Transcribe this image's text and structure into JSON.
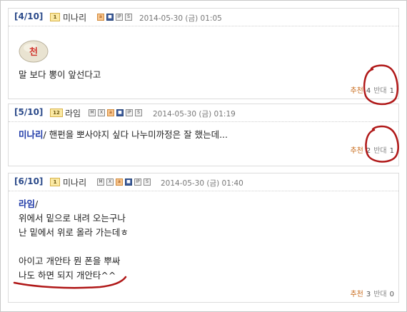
{
  "comments": [
    {
      "index": "[4/10]",
      "level": "1",
      "nick": "미나리",
      "badges": [
        "a",
        "■",
        "IP",
        "S"
      ],
      "date": "2014-05-30 (금) 01:05",
      "emoticon_text": "천",
      "lines": [
        "말 보다 뽕이 앞선다고"
      ],
      "recommend_label": "추천",
      "recommend_count": "4",
      "oppose_label": "반대",
      "oppose_count": "1"
    },
    {
      "index": "[5/10]",
      "level": "12",
      "nick": "라임",
      "badges": [
        "M",
        "X",
        "a",
        "■",
        "IP",
        "S"
      ],
      "date": "2014-05-30 (금) 01:19",
      "mention": "미나리",
      "lines": [
        "/ 핸펀을 뽀사야지 싶다 나누미까정은 잘 했는데..."
      ],
      "recommend_label": "추천",
      "recommend_count": "2",
      "oppose_label": "반대",
      "oppose_count": "1"
    },
    {
      "index": "[6/10]",
      "level": "1",
      "nick": "미나리",
      "badges": [
        "M",
        "X",
        "a",
        "■",
        "IP",
        "S"
      ],
      "date": "2014-05-30 (금) 01:40",
      "mention": "라임",
      "lines": [
        "/",
        "위에서 밑으로 내려 오는구나",
        "난 밑에서 위로 올라 가는데ㅎ",
        "",
        "아이고 개안타 뭔 폰을 뿌싸",
        "나도 하면 되지 개안타^^"
      ],
      "recommend_label": "추천",
      "recommend_count": "3",
      "oppose_label": "반대",
      "oppose_count": "0"
    }
  ],
  "colors": {
    "index": "#2b4a8a",
    "mention": "#1f3aa8",
    "recommend": "#c86a1a",
    "annotation": "#b01818"
  }
}
